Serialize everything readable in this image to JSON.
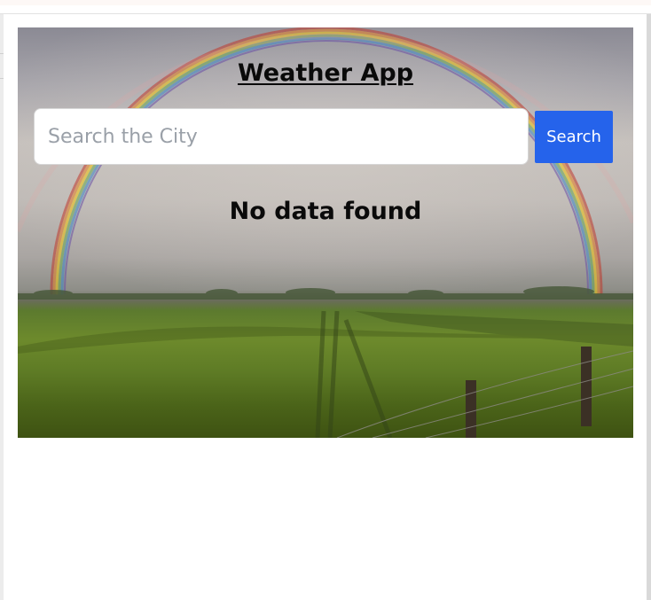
{
  "app": {
    "title": "Weather App"
  },
  "search": {
    "placeholder": "Search the City",
    "value": "",
    "button_label": "Search"
  },
  "result": {
    "status_text": "No data found"
  },
  "icons": {
    "background": "rainbow-field-photo"
  },
  "colors": {
    "button": "#2563eb",
    "button_text": "#ffffff",
    "title_text": "#0a0a0a"
  }
}
